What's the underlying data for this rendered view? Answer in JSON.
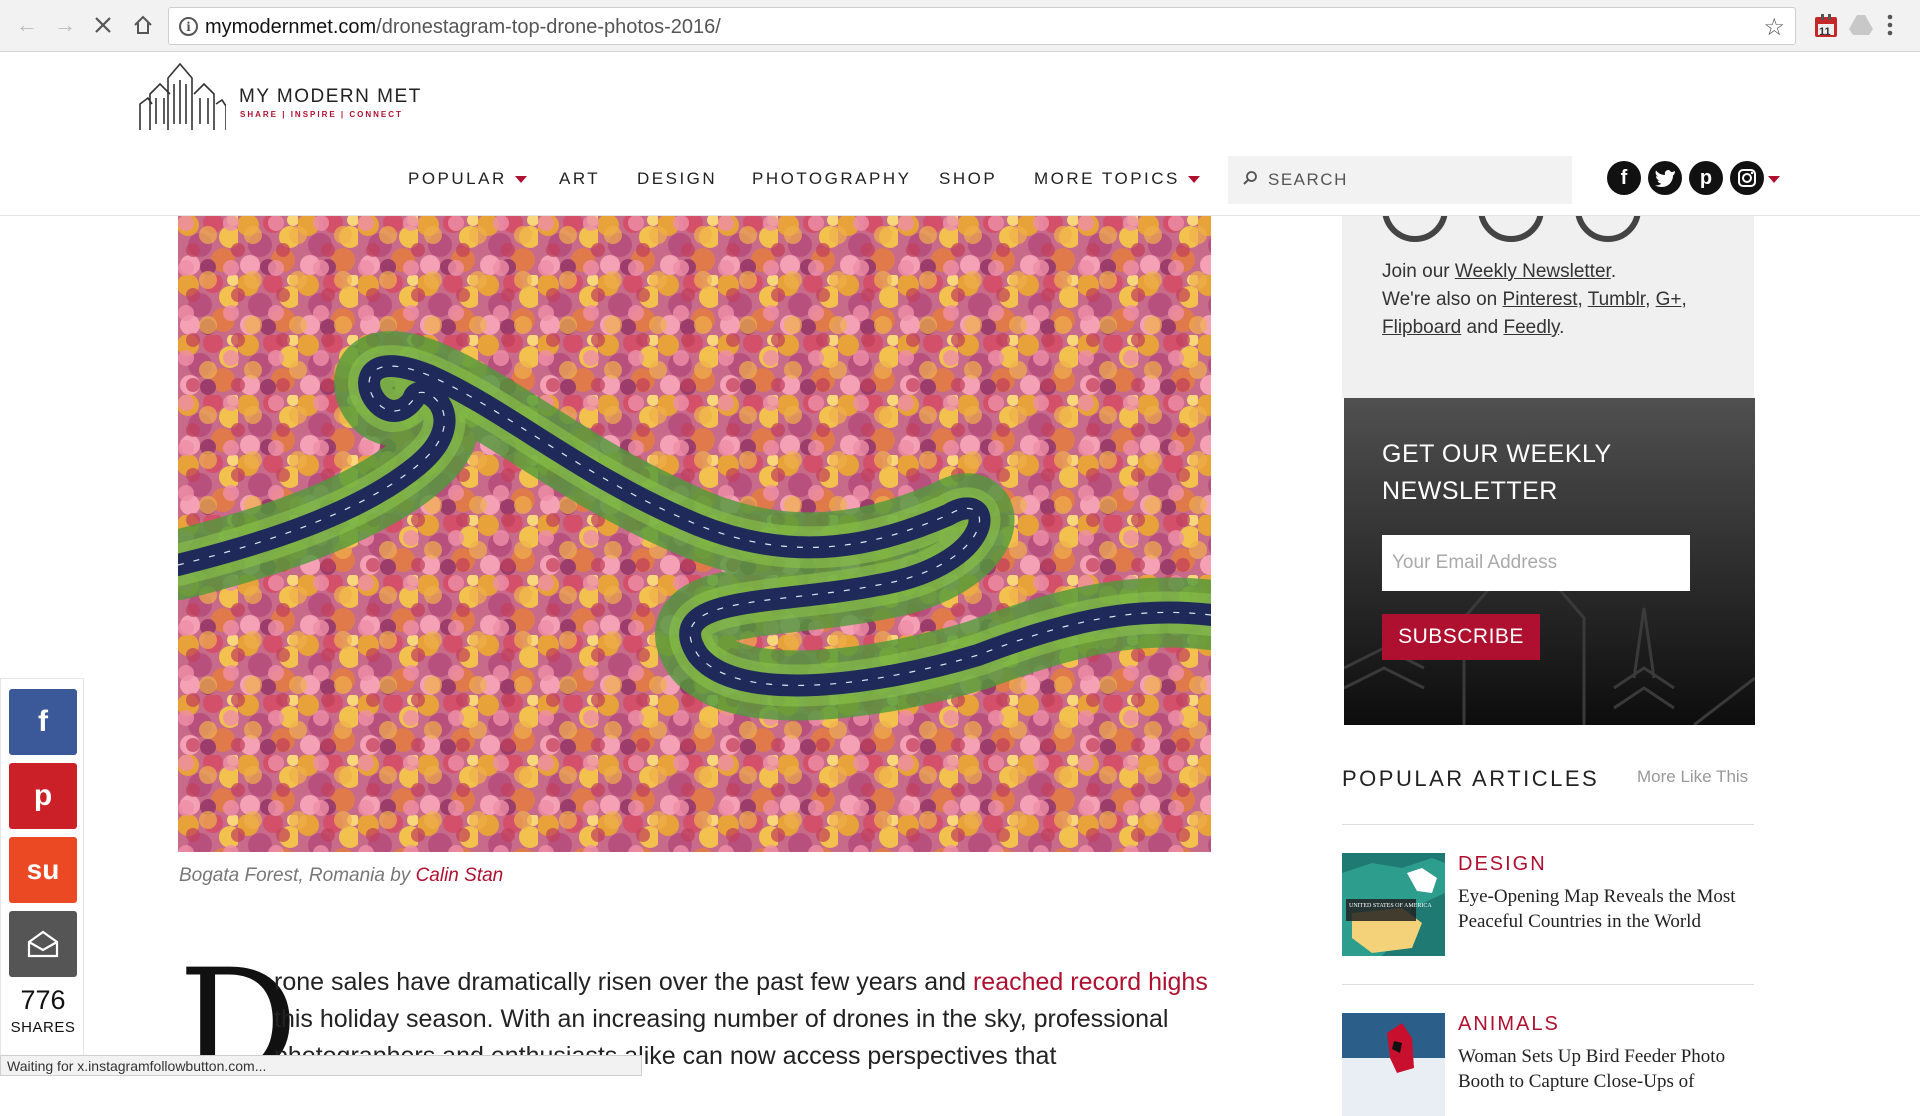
{
  "browser": {
    "url_host": "mymodernmet.com",
    "url_path": "/dronestagram-top-drone-photos-2016/",
    "extension_badge": "11",
    "status_text": "Waiting for x.instagramfollowbutton.com..."
  },
  "site": {
    "logo_title": "MY MODERN MET",
    "logo_tagline": "SHARE | INSPIRE | CONNECT"
  },
  "nav": {
    "items": [
      "POPULAR",
      "ART",
      "DESIGN",
      "PHOTOGRAPHY",
      "SHOP",
      "MORE TOPICS"
    ],
    "search_placeholder": "SEARCH"
  },
  "article": {
    "caption_place": "Bogata Forest, Romania by ",
    "caption_author": "Calin Stan",
    "dropcap": "D",
    "body_1": "rone sales have dramatically risen over the past few years and ",
    "body_link": "reached record highs",
    "body_2": " this holiday season. With an increasing number of drones in the sky, professional photographers and enthusiasts alike can now access perspectives that"
  },
  "sidebar": {
    "join_prefix": "Join our ",
    "weekly_newsletter": "Weekly Newsletter",
    "join_suffix": ".",
    "also_prefix": "We're also on ",
    "pinterest": "Pinterest",
    "tumblr": "Tumblr",
    "gplus": "G+",
    "flipboard": "Flipboard",
    "and": " and ",
    "feedly": "Feedly",
    "newsletter_title": "GET OUR WEEKLY NEWSLETTER",
    "email_placeholder": "Your Email Address",
    "subscribe": "SUBSCRIBE",
    "popular_heading": "POPULAR ARTICLES",
    "more_like_this": "More Like This",
    "articles": [
      {
        "category": "DESIGN",
        "title": "Eye-Opening Map Reveals the Most Peaceful Countries in the World",
        "thumb_label": "UNITED STATES OF AMERICA"
      },
      {
        "category": "ANIMALS",
        "title": "Woman Sets Up Bird Feeder Photo Booth to Capture Close-Ups of"
      }
    ]
  },
  "share": {
    "count": "776",
    "label": "SHARES"
  },
  "colors": {
    "brand_red": "#b0102f",
    "facebook": "#3b5998",
    "pinterest": "#cb2027",
    "stumbleupon": "#eb4924",
    "newsletter_bg": "#1a1a1a"
  }
}
